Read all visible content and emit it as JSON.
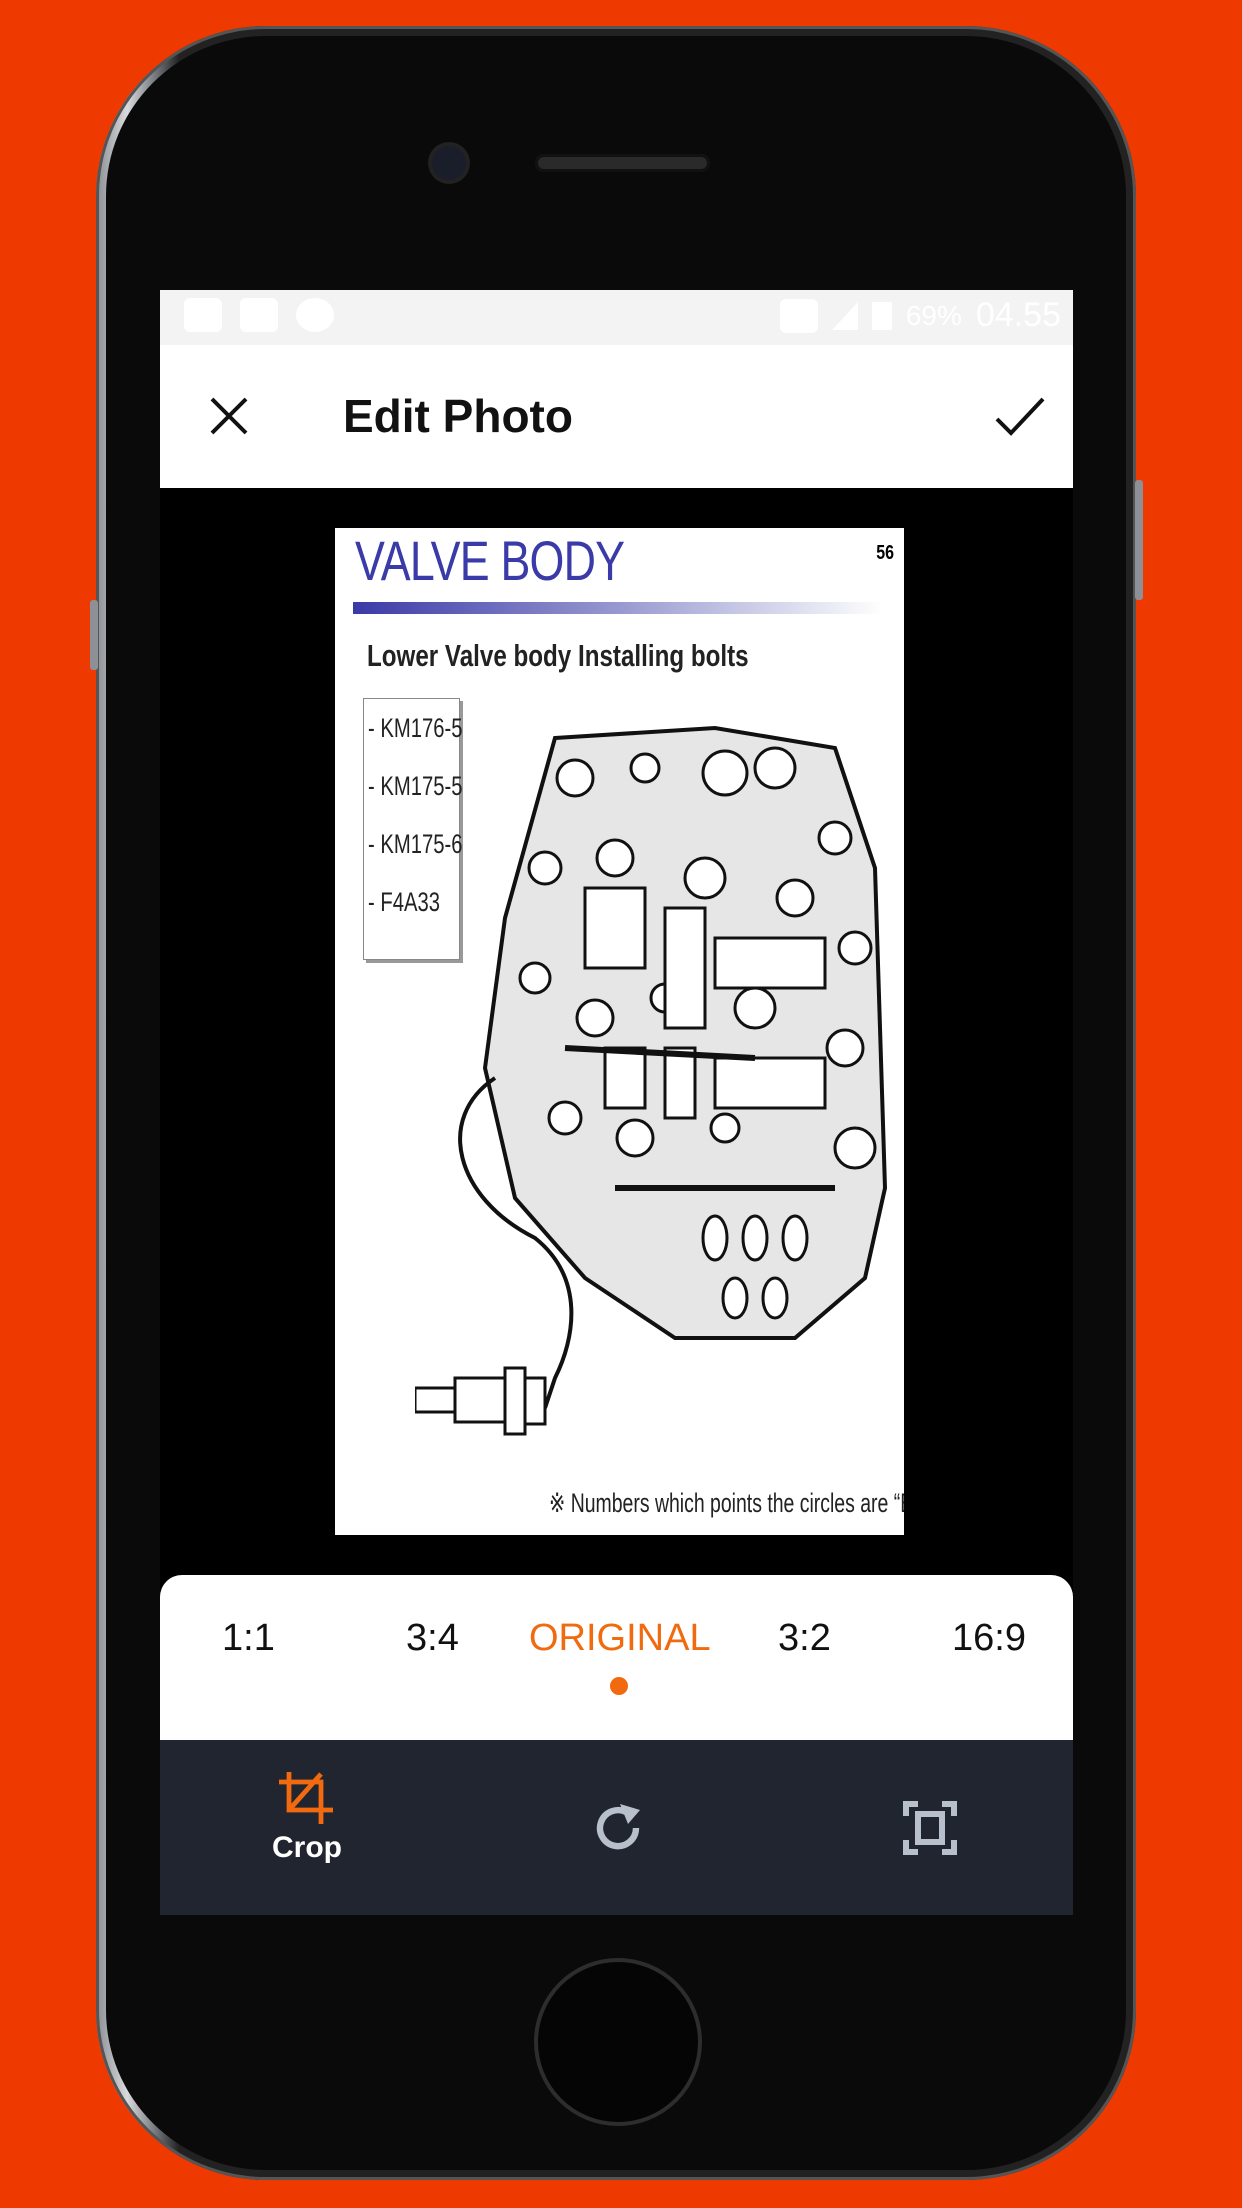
{
  "status_bar": {
    "battery": "69%",
    "time": "04.55",
    "icons": [
      "message-icon",
      "youtube-icon",
      "shutter-icon",
      "cast-icon",
      "signal-icon",
      "battery-icon"
    ]
  },
  "header": {
    "title": "Edit Photo",
    "close_icon": "close-icon",
    "confirm_icon": "check-icon"
  },
  "photo": {
    "heading": "VALVE BODY",
    "page_number": "56",
    "subtitle": "Lower Valve body Installing bolts",
    "legend": [
      "- KM176-5",
      "- KM175-5",
      "- KM175-6",
      "- F4A33"
    ],
    "note": "※ Numbers which points the circles are “Bolt length”"
  },
  "aspect_ratios": {
    "options": [
      "1:1",
      "3:4",
      "ORIGINAL",
      "3:2",
      "16:9"
    ],
    "selected": "ORIGINAL"
  },
  "toolbar": {
    "crop_label": "Crop",
    "items": [
      "crop-icon",
      "rotate-icon",
      "fit-screen-icon"
    ]
  },
  "colors": {
    "accent": "#f26a10",
    "background": "#ee3a00",
    "toolbar": "#21252f"
  }
}
